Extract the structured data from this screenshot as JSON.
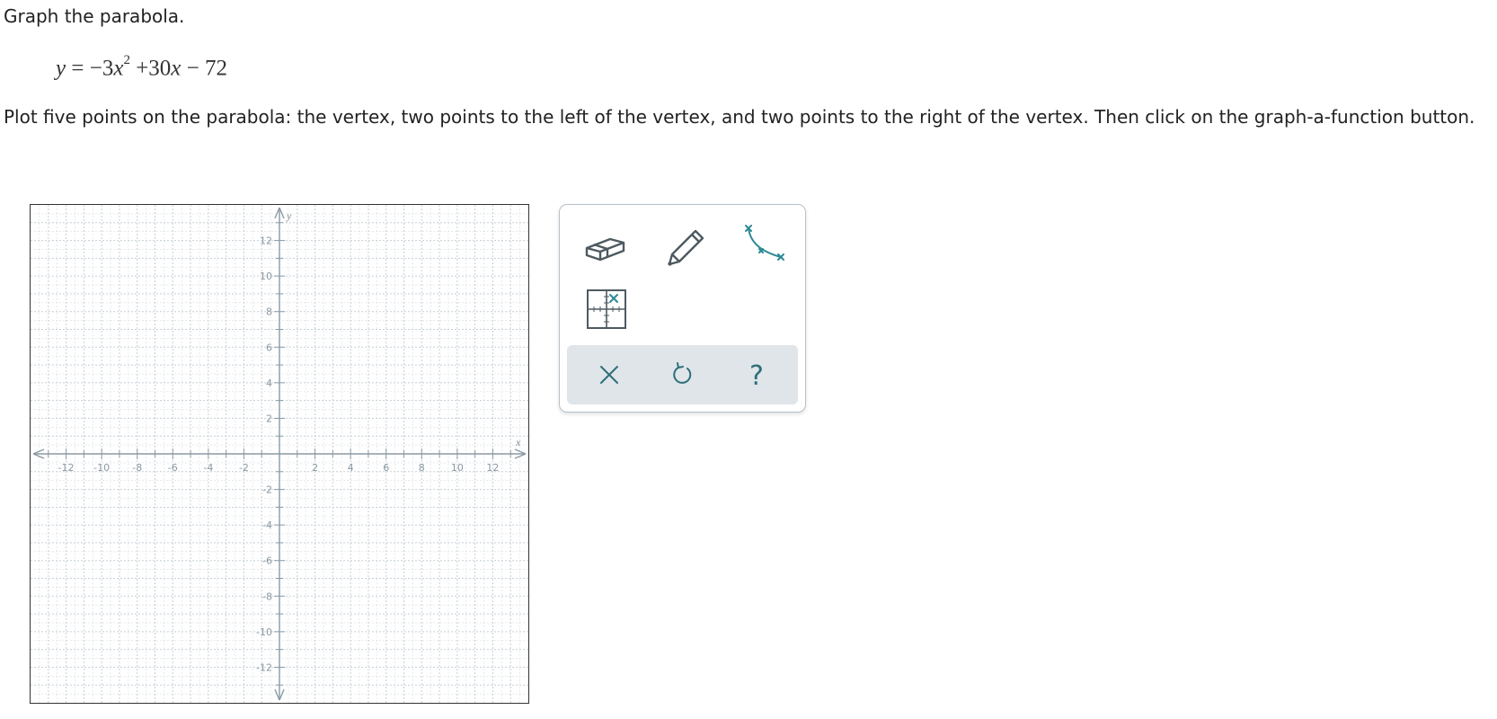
{
  "prompt": "Graph the parabola.",
  "equation": {
    "lhs": "y",
    "eq": "=",
    "minus": "−",
    "coef_a": "3",
    "var1": "x",
    "exp": "2",
    "plus": "+",
    "coef_b": "30",
    "var2": "x",
    "minus2": "−",
    "const": "72"
  },
  "instructions": "Plot five points on the parabola: the vertex, two points to the left of the vertex, and two points to the right of the vertex. Then click on the graph-a-function button.",
  "graph": {
    "x_axis_label": "x",
    "y_axis_label": "y",
    "x_range": [
      -14,
      14
    ],
    "y_range": [
      -14,
      14
    ],
    "minor_step": 1,
    "label_step": 2,
    "x_tick_labels": [
      "-12",
      "-10",
      "-8",
      "-6",
      "-4",
      "-2",
      "2",
      "4",
      "6",
      "8",
      "10",
      "12"
    ],
    "y_tick_labels": [
      "12",
      "10",
      "8",
      "6",
      "4",
      "2",
      "-2",
      "-4",
      "-6",
      "-8",
      "-10",
      "-12"
    ],
    "grid_color": "#c5cfd6",
    "axis_color": "#8a9aa5"
  },
  "toolbox": {
    "tools": [
      "eraser-icon",
      "pencil-icon",
      "graph-a-function-icon",
      "grid-point-icon"
    ],
    "actions": [
      "clear-icon",
      "undo-icon",
      "help-icon"
    ],
    "help_glyph": "?",
    "accent_color": "#2e8a96",
    "icon_color": "#4e5a60"
  }
}
